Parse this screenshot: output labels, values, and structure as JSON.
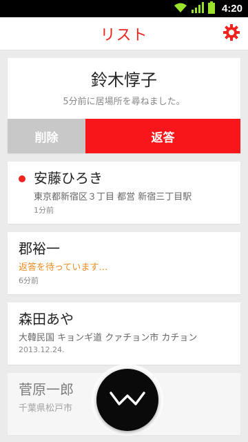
{
  "status_bar": {
    "time": "4:20"
  },
  "header": {
    "title": "リスト"
  },
  "request": {
    "name": "鈴木惇子",
    "message": "5分前に居場所を尋ねました。",
    "delete_label": "削除",
    "reply_label": "返答"
  },
  "contacts": [
    {
      "name": "安藤ひろき",
      "location": "東京都新宿区３丁目 都営 新宿三丁目駅",
      "time": "1分前"
    },
    {
      "name": "郡裕一",
      "location": "返答を待っています…",
      "time": "6分前"
    },
    {
      "name": "森田あや",
      "location": "大韓民国 キョンギ道 クァチョン市 カチョン",
      "time": "2013.12.24."
    },
    {
      "name": "菅原一郎",
      "location": "千葉県松戸市"
    }
  ],
  "colors": {
    "accent": "#f0231e",
    "reply": "#f8161a",
    "delete": "#c8c8c8",
    "waiting": "#f08a1e"
  },
  "icons": {
    "settings": "gear-icon",
    "fab": "wave-logo-icon"
  }
}
